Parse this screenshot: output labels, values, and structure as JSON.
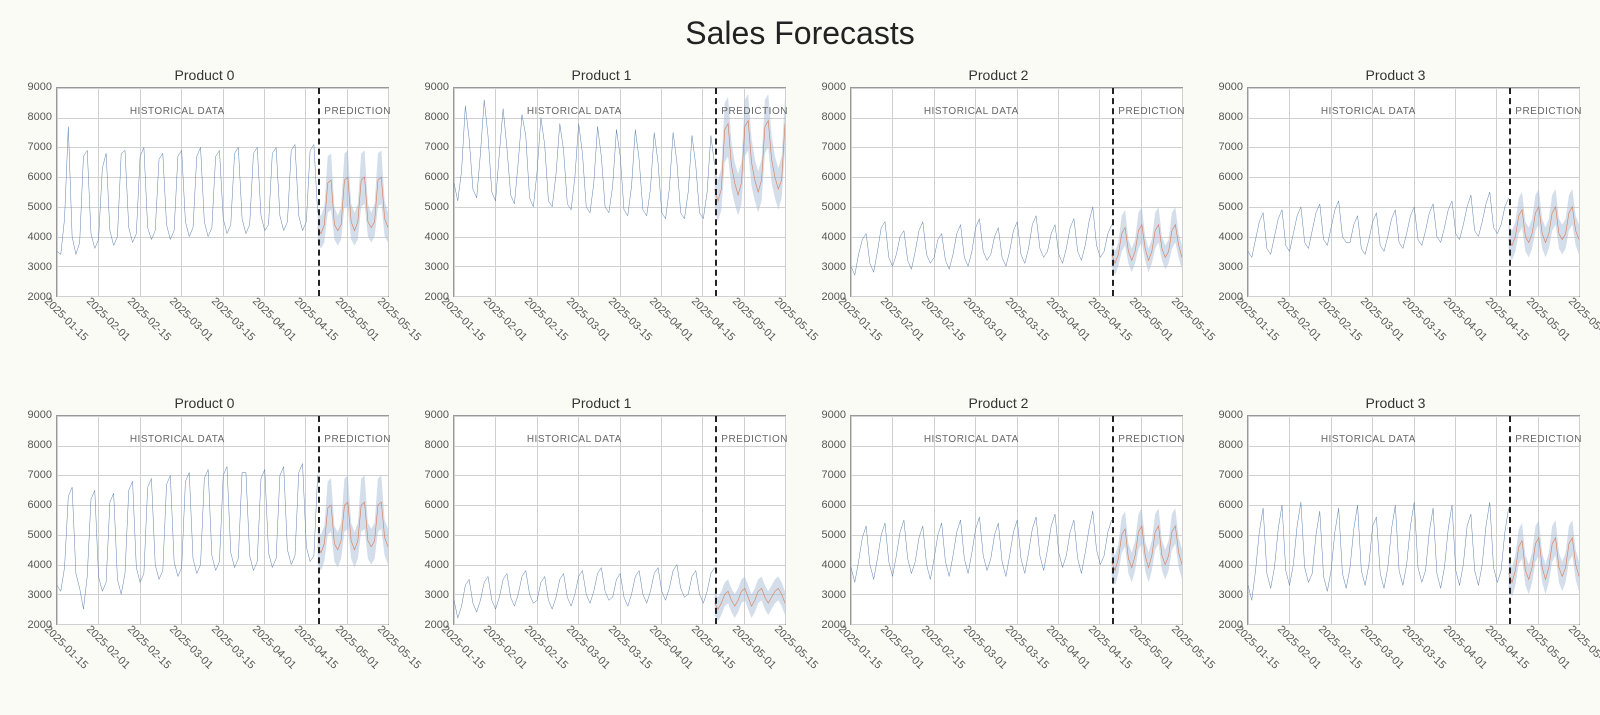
{
  "title": "Sales Forecasts",
  "colors": {
    "historical": "#5b7fae",
    "prediction": "#d67b58",
    "ci": "#aabdd5"
  },
  "annotations": {
    "historical": "HISTORICAL DATA",
    "prediction": "PREDICTION"
  },
  "y_axis": {
    "ticks": [
      2000,
      3000,
      4000,
      5000,
      6000,
      7000,
      8000,
      9000
    ],
    "min": 2000,
    "max": 9000
  },
  "x_axis": {
    "ticks": [
      "2025-01-15",
      "2025-02-01",
      "2025-02-15",
      "2025-03-01",
      "2025-03-15",
      "2025-04-01",
      "2025-04-15",
      "2025-05-01",
      "2025-05-15"
    ],
    "min_index": 0,
    "max_index": 8,
    "split_index": 6.3
  },
  "chart_data": [
    {
      "title": "Product 0",
      "historical": [
        3500,
        3400,
        4600,
        7700,
        4000,
        3400,
        3800,
        6700,
        6900,
        4100,
        3600,
        3900,
        6300,
        6800,
        4200,
        3700,
        4000,
        6800,
        6900,
        4300,
        3800,
        4100,
        6700,
        7000,
        4300,
        3900,
        4200,
        6600,
        6800,
        4400,
        3900,
        4200,
        6700,
        6900,
        4500,
        4000,
        4300,
        6700,
        7000,
        4500,
        4000,
        4300,
        6700,
        6900,
        4600,
        4100,
        4400,
        6800,
        7000,
        4600,
        4100,
        4400,
        6800,
        7000,
        4700,
        4200,
        4400,
        6800,
        7000,
        4700,
        4200,
        4500,
        6900,
        7100,
        4700,
        4200,
        4500,
        6900,
        7100,
        4800
      ],
      "prediction": [
        4300,
        4100,
        4400,
        5800,
        5900,
        4400,
        4200,
        4400,
        5900,
        6000,
        4500,
        4200,
        4500,
        5900,
        6000,
        4500,
        4300,
        4500,
        5900,
        6000,
        4600,
        4300
      ],
      "ci_low": [
        3800,
        3600,
        3800,
        4800,
        4900,
        3900,
        3700,
        3900,
        5000,
        5000,
        3900,
        3700,
        3900,
        5000,
        5100,
        4000,
        3800,
        4000,
        5000,
        5100,
        4000,
        3800
      ],
      "ci_high": [
        4800,
        4700,
        5000,
        6700,
        6800,
        5000,
        4700,
        5000,
        6800,
        6900,
        5100,
        4800,
        5100,
        6800,
        6900,
        5100,
        4800,
        5100,
        6800,
        6900,
        5200,
        4800
      ]
    },
    {
      "title": "Product 1",
      "historical": [
        5800,
        5200,
        6200,
        8400,
        7300,
        5600,
        5300,
        6800,
        8600,
        7400,
        5500,
        5200,
        6800,
        8300,
        7000,
        5400,
        5100,
        6500,
        8100,
        7400,
        5300,
        5000,
        6200,
        8000,
        7100,
        5200,
        5000,
        6100,
        7800,
        6900,
        5100,
        4900,
        6000,
        7800,
        6800,
        5000,
        4800,
        5800,
        7700,
        6700,
        5000,
        4800,
        5700,
        7600,
        6700,
        4900,
        4700,
        5700,
        7600,
        6600,
        4900,
        4700,
        5600,
        7500,
        6500,
        4800,
        4600,
        5600,
        7500,
        6500,
        4800,
        4600,
        5500,
        7400,
        6400,
        4800,
        4600,
        5500,
        7400,
        6400
      ],
      "prediction": [
        5600,
        5200,
        5600,
        7600,
        7800,
        6400,
        5800,
        5400,
        5800,
        7700,
        7900,
        6500,
        5900,
        5500,
        5900,
        7700,
        7900,
        6600,
        6000,
        5600,
        5900,
        7800
      ],
      "ci_low": [
        4900,
        4500,
        4900,
        6500,
        6700,
        5600,
        5100,
        4700,
        5100,
        6700,
        6900,
        5700,
        5200,
        4800,
        5200,
        6800,
        7000,
        5800,
        5300,
        4900,
        5300,
        6900
      ],
      "ci_high": [
        6300,
        5900,
        6300,
        8500,
        8700,
        7200,
        6500,
        6100,
        6500,
        8600,
        8800,
        7300,
        6600,
        6200,
        6600,
        8600,
        8800,
        7400,
        6700,
        6300,
        6700,
        8700
      ]
    },
    {
      "title": "Product 2",
      "historical": [
        3000,
        2700,
        3400,
        3900,
        4100,
        3100,
        2800,
        3500,
        4300,
        4500,
        3300,
        3000,
        3400,
        4000,
        4200,
        3200,
        2900,
        3500,
        4200,
        4500,
        3400,
        3100,
        3300,
        3900,
        4100,
        3200,
        2900,
        3400,
        4100,
        4400,
        3300,
        3000,
        3500,
        4300,
        4600,
        3500,
        3200,
        3400,
        4000,
        4300,
        3300,
        3000,
        3500,
        4200,
        4500,
        3400,
        3100,
        3600,
        4400,
        4700,
        3600,
        3300,
        3500,
        4100,
        4400,
        3400,
        3100,
        3600,
        4300,
        4600,
        3500,
        3200,
        3700,
        4500,
        5000,
        3700,
        3300,
        3500,
        4100,
        4400
      ],
      "prediction": [
        3400,
        3100,
        3400,
        4100,
        4300,
        3500,
        3200,
        3500,
        4200,
        4400,
        3600,
        3200,
        3500,
        4200,
        4400,
        3600,
        3300,
        3500,
        4200,
        4400,
        3700,
        3300
      ],
      "ci_low": [
        3000,
        2700,
        3000,
        3500,
        3700,
        3100,
        2800,
        3100,
        3600,
        3800,
        3200,
        2800,
        3100,
        3600,
        3800,
        3200,
        2900,
        3100,
        3600,
        3800,
        3300,
        2900
      ],
      "ci_high": [
        3800,
        3500,
        3800,
        4700,
        4900,
        3900,
        3600,
        3900,
        4800,
        5000,
        4000,
        3600,
        3900,
        4800,
        5000,
        4000,
        3700,
        3900,
        4800,
        5000,
        4100,
        3700
      ]
    },
    {
      "title": "Product 3",
      "historical": [
        3500,
        3300,
        3900,
        4500,
        4800,
        3600,
        3400,
        4000,
        4600,
        4900,
        3700,
        3500,
        4100,
        4700,
        5000,
        3800,
        3600,
        4200,
        4800,
        5100,
        3900,
        3700,
        4300,
        4900,
        5200,
        4000,
        3800,
        3800,
        4400,
        4700,
        3600,
        3400,
        3900,
        4500,
        4800,
        3700,
        3500,
        4000,
        4600,
        4900,
        3800,
        3600,
        4100,
        4700,
        5000,
        3900,
        3700,
        4200,
        4800,
        5100,
        4000,
        3800,
        4300,
        4900,
        5200,
        4100,
        3900,
        4400,
        5000,
        5400,
        4200,
        4000,
        4500,
        5100,
        5500,
        4300,
        4100,
        4400,
        5000,
        5300
      ],
      "prediction": [
        3900,
        3700,
        4000,
        4700,
        4900,
        4000,
        3800,
        4100,
        4800,
        5000,
        4100,
        3800,
        4100,
        4800,
        5000,
        4100,
        3900,
        4100,
        4800,
        5000,
        4200,
        3900
      ],
      "ci_low": [
        3400,
        3200,
        3500,
        4100,
        4300,
        3500,
        3300,
        3600,
        4200,
        4400,
        3600,
        3300,
        3600,
        4200,
        4400,
        3600,
        3400,
        3600,
        4200,
        4400,
        3700,
        3400
      ],
      "ci_high": [
        4400,
        4200,
        4500,
        5300,
        5500,
        4500,
        4300,
        4600,
        5400,
        5600,
        4600,
        4300,
        4600,
        5400,
        5600,
        4600,
        4400,
        4600,
        5400,
        5600,
        4700,
        4400
      ]
    },
    {
      "title": "Product 0",
      "historical": [
        3300,
        3100,
        3900,
        6300,
        6600,
        3700,
        3200,
        2500,
        3600,
        6200,
        6500,
        3600,
        3100,
        3400,
        6100,
        6400,
        3500,
        3000,
        3700,
        6500,
        6800,
        3900,
        3400,
        3700,
        6600,
        6900,
        4000,
        3500,
        3800,
        6700,
        7000,
        4100,
        3600,
        3900,
        6800,
        7100,
        4200,
        3700,
        4000,
        6900,
        7200,
        4300,
        3800,
        4100,
        7000,
        7300,
        4400,
        3900,
        4200,
        7100,
        7100,
        4300,
        3800,
        4100,
        6900,
        7200,
        4400,
        3900,
        4200,
        7000,
        7300,
        4500,
        4000,
        4300,
        7100,
        7400,
        4600,
        4100,
        4300,
        7000
      ],
      "prediction": [
        4600,
        4400,
        4700,
        5900,
        6000,
        4700,
        4500,
        4800,
        6000,
        6100,
        4800,
        4500,
        4800,
        6000,
        6100,
        4800,
        4600,
        4800,
        6000,
        6100,
        4900,
        4600
      ],
      "ci_low": [
        4000,
        3800,
        4100,
        5000,
        5100,
        4100,
        3900,
        4200,
        5100,
        5200,
        4200,
        3900,
        4200,
        5100,
        5200,
        4200,
        4000,
        4200,
        5100,
        5200,
        4300,
        4000
      ],
      "ci_high": [
        5200,
        5000,
        5300,
        6800,
        6900,
        5300,
        5100,
        5400,
        6900,
        7000,
        5400,
        5100,
        5400,
        6900,
        7000,
        5400,
        5200,
        5400,
        6900,
        7000,
        5500,
        5200
      ]
    },
    {
      "title": "Product 1",
      "historical": [
        2800,
        2200,
        2600,
        3300,
        3500,
        2700,
        2400,
        2800,
        3400,
        3600,
        2800,
        2500,
        2900,
        3500,
        3700,
        2900,
        2600,
        3000,
        3600,
        3800,
        3000,
        2700,
        2800,
        3400,
        3600,
        2800,
        2500,
        2900,
        3500,
        3700,
        2900,
        2600,
        3000,
        3600,
        3800,
        3000,
        2700,
        3100,
        3700,
        3900,
        3100,
        2800,
        2900,
        3500,
        3700,
        2900,
        2600,
        3000,
        3600,
        3800,
        3000,
        2700,
        3100,
        3700,
        3900,
        3100,
        2800,
        3200,
        3800,
        4000,
        3200,
        2900,
        3000,
        3600,
        3800,
        3000,
        2700,
        3100,
        3700,
        3900
      ],
      "prediction": [
        2700,
        2500,
        2700,
        3000,
        3100,
        2800,
        2600,
        2800,
        3100,
        3200,
        2900,
        2600,
        2800,
        3100,
        3200,
        2900,
        2700,
        2900,
        3100,
        3200,
        3000,
        2700
      ],
      "ci_low": [
        2300,
        2100,
        2300,
        2600,
        2700,
        2400,
        2200,
        2400,
        2700,
        2800,
        2500,
        2200,
        2400,
        2700,
        2800,
        2500,
        2300,
        2500,
        2700,
        2800,
        2600,
        2300
      ],
      "ci_high": [
        3100,
        2900,
        3100,
        3400,
        3500,
        3200,
        3000,
        3200,
        3500,
        3600,
        3300,
        3000,
        3200,
        3500,
        3600,
        3300,
        3100,
        3300,
        3500,
        3600,
        3400,
        3100
      ]
    },
    {
      "title": "Product 2",
      "historical": [
        3900,
        3400,
        4100,
        4900,
        5300,
        4000,
        3500,
        4200,
        5000,
        5400,
        4100,
        3600,
        4300,
        5100,
        5500,
        4200,
        3700,
        4100,
        4900,
        5300,
        4000,
        3500,
        4200,
        5000,
        5400,
        4100,
        3600,
        4300,
        5100,
        5500,
        4200,
        3700,
        4400,
        5200,
        5600,
        4300,
        3800,
        4200,
        5000,
        5400,
        4100,
        3600,
        4300,
        5100,
        5500,
        4200,
        3700,
        4400,
        5200,
        5600,
        4300,
        3800,
        4500,
        5300,
        5700,
        4400,
        3900,
        4300,
        5100,
        5500,
        4200,
        3700,
        4400,
        5200,
        5800,
        4500,
        4000,
        4300,
        5100,
        5500
      ],
      "prediction": [
        4100,
        3800,
        4200,
        5000,
        5200,
        4200,
        3900,
        4300,
        5100,
        5300,
        4300,
        3900,
        4300,
        5100,
        5300,
        4300,
        4000,
        4300,
        5100,
        5300,
        4400,
        4000
      ],
      "ci_low": [
        3600,
        3300,
        3700,
        4400,
        4600,
        3700,
        3400,
        3800,
        4500,
        4700,
        3800,
        3400,
        3800,
        4500,
        4700,
        3800,
        3500,
        3800,
        4500,
        4700,
        3900,
        3500
      ],
      "ci_high": [
        4600,
        4300,
        4700,
        5600,
        5800,
        4700,
        4400,
        4800,
        5700,
        5900,
        4800,
        4400,
        4800,
        5700,
        5900,
        4800,
        4500,
        4800,
        5700,
        5900,
        4900,
        4500
      ]
    },
    {
      "title": "Product 3",
      "historical": [
        3300,
        2800,
        3800,
        5100,
        5900,
        3700,
        3200,
        3900,
        5200,
        6000,
        3800,
        3300,
        4000,
        5300,
        6100,
        3900,
        3400,
        3700,
        5000,
        5800,
        3600,
        3100,
        3800,
        5100,
        5900,
        3700,
        3200,
        3900,
        5200,
        6000,
        3800,
        3300,
        4000,
        5300,
        5600,
        3700,
        3200,
        3900,
        5200,
        6000,
        3800,
        3300,
        4000,
        5300,
        6100,
        3900,
        3400,
        3800,
        5100,
        5900,
        3700,
        3200,
        3900,
        5200,
        6000,
        3800,
        3300,
        4000,
        5300,
        5700,
        3800,
        3300,
        4000,
        5300,
        6100,
        3900,
        3400,
        3800,
        5100,
        5900
      ],
      "prediction": [
        3700,
        3400,
        3800,
        4600,
        4800,
        3800,
        3500,
        3900,
        4700,
        4900,
        3900,
        3500,
        3900,
        4700,
        4900,
        3900,
        3600,
        3900,
        4700,
        4900,
        4000,
        3600
      ],
      "ci_low": [
        3200,
        2900,
        3300,
        4000,
        4200,
        3300,
        3000,
        3400,
        4100,
        4300,
        3400,
        3000,
        3400,
        4100,
        4300,
        3400,
        3100,
        3400,
        4100,
        4300,
        3500,
        3100
      ],
      "ci_high": [
        4200,
        3900,
        4300,
        5200,
        5400,
        4300,
        4000,
        4400,
        5300,
        5500,
        4400,
        4000,
        4400,
        5300,
        5500,
        4400,
        4100,
        4400,
        5300,
        5500,
        4500,
        4100
      ]
    }
  ]
}
